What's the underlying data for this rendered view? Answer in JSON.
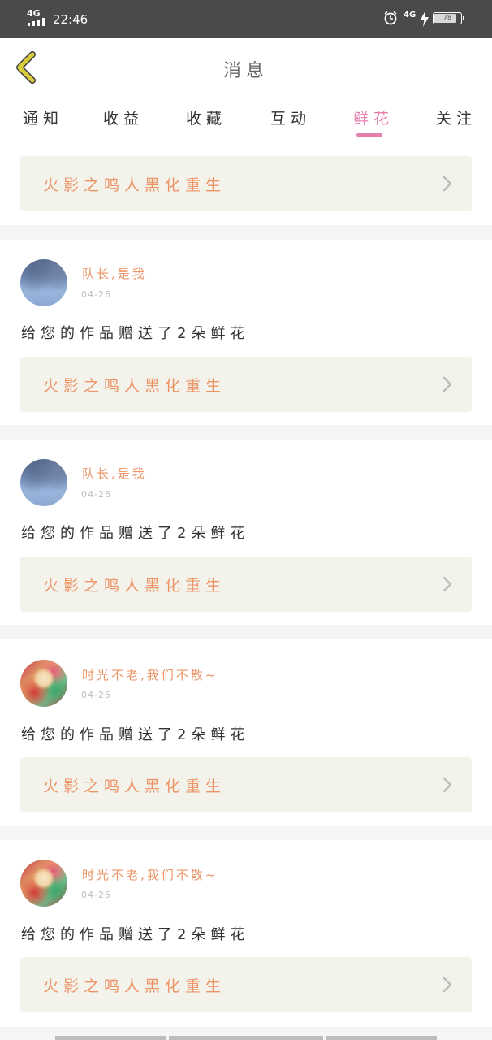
{
  "status_bar": {
    "network": "4G",
    "time": "22:46",
    "network2": "4G",
    "battery": "78",
    "battery_level": 0.78,
    "icons": [
      "signal-icon",
      "alarm-icon",
      "charging-bolt-icon",
      "battery-icon"
    ]
  },
  "header": {
    "title": "消息",
    "back_icon": "chevron-left-icon",
    "back_color": "#d9cc3a"
  },
  "tabs": [
    {
      "label": "通知"
    },
    {
      "label": "收益"
    },
    {
      "label": "收藏"
    },
    {
      "label": "互动"
    },
    {
      "label": "鲜花",
      "active": true
    },
    {
      "label": "关注"
    }
  ],
  "accent_color": "#e57fae",
  "link_color": "#ec9466",
  "top_link": {
    "title": "火影之鸣人黑化重生"
  },
  "messages": [
    {
      "user": "队长,是我",
      "date": "04-26",
      "avatar": "snow-landscape-avatar",
      "text": "给您的作品赠送了2朵鲜花",
      "work": "火影之鸣人黑化重生"
    },
    {
      "user": "队长,是我",
      "date": "04-26",
      "avatar": "snow-landscape-avatar",
      "text": "给您的作品赠送了2朵鲜花",
      "work": "火影之鸣人黑化重生"
    },
    {
      "user": "时光不老,我们不散~",
      "date": "04-25",
      "avatar": "anime-girl-avatar",
      "text": "给您的作品赠送了2朵鲜花",
      "work": "火影之鸣人黑化重生"
    },
    {
      "user": "时光不老,我们不散~",
      "date": "04-25",
      "avatar": "anime-girl-avatar",
      "text": "给您的作品赠送了2朵鲜花",
      "work": "火影之鸣人黑化重生"
    }
  ]
}
